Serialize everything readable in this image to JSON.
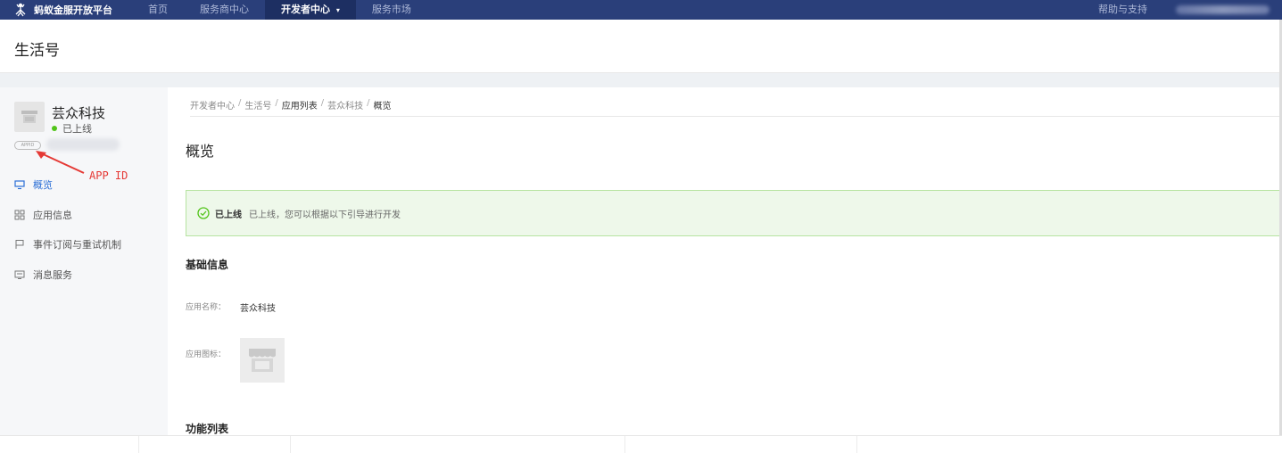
{
  "topbar": {
    "brand": "蚂蚁金服开放平台",
    "nav": [
      "首页",
      "服务商中心",
      "开发者中心",
      "服务市场"
    ],
    "active_nav": "开发者中心",
    "help": "帮助与支持",
    "colors": {
      "bar": "#2a3f7a",
      "active": "#1d2f62"
    }
  },
  "titlebar": {
    "title": "生活号"
  },
  "sidebar": {
    "app_name": "芸众科技",
    "status": "已上线",
    "appid_tag": "APPID",
    "annotation": "APP ID",
    "menu": [
      {
        "label": "概览",
        "icon": "monitor-icon",
        "active": true
      },
      {
        "label": "应用信息",
        "icon": "grid-icon",
        "active": false
      },
      {
        "label": "事件订阅与重试机制",
        "icon": "flag-icon",
        "active": false
      },
      {
        "label": "消息服务",
        "icon": "message-icon",
        "active": false
      }
    ]
  },
  "main": {
    "breadcrumb": [
      "开发者中心",
      "生活号",
      "应用列表",
      "芸众科技",
      "概览"
    ],
    "page_title": "概览",
    "alert": {
      "title": "已上线",
      "text": "已上线，您可以根据以下引导进行开发",
      "icon": "check-circle-icon"
    },
    "basic_info_title": "基础信息",
    "app_name_label": "应用名称：",
    "app_name_value": "芸众科技",
    "app_icon_label": "应用图标：",
    "features_title": "功能列表"
  }
}
